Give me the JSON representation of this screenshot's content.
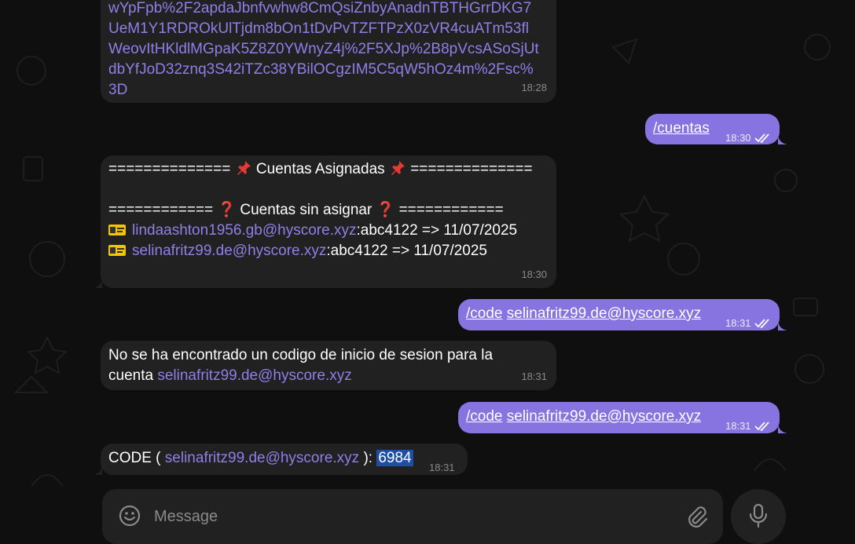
{
  "messages": [
    {
      "link_lines": [
        "wYpFpb%2F2apdaJbnfvwhw8CmQsiZnbyAnadnTBTHGrrDKG7",
        "UeM1Y1RDROkUlTjdm8bOn1tDvPvTZFTPzX0zVR4cuATm53fl",
        "WeovItHKldlMGpaK5Z8Z0YWnyZ4j%2F5XJp%2B8pVcsASoSjUt",
        "dbYfJoD32znq3S42iTZc38YBilOCgzIM5C5qW5hOz4m%2Fsc%",
        "3D"
      ],
      "time": "18:28"
    },
    {
      "command": "/cuentas",
      "time": "18:30"
    },
    {
      "header_prefix": "==============",
      "header_title": "Cuentas Asignadas",
      "header_suffix": "==============",
      "subheader_prefix": "============",
      "subheader_title": "Cuentas sin asignar",
      "subheader_suffix": "============",
      "accounts": [
        {
          "email": "lindaashton1956.gb@hyscore.xyz",
          "detail": ":abc4122 => 11/07/2025"
        },
        {
          "email": "selinafritz99.de@hyscore.xyz",
          "detail": ":abc4122 => 11/07/2025"
        }
      ],
      "time": "18:30"
    },
    {
      "command": "/code",
      "arg": "selinafritz99.de@hyscore.xyz",
      "time": "18:31"
    },
    {
      "text_line1": "No se ha encontrado un codigo de inicio de sesion para la",
      "text_line2": "cuenta",
      "email": "selinafritz99.de@hyscore.xyz",
      "time": "18:31"
    },
    {
      "command": "/code",
      "arg": "selinafritz99.de@hyscore.xyz",
      "time": "18:31"
    },
    {
      "prefix": "CODE (",
      "email": "selinafritz99.de@hyscore.xyz",
      "suffix": "):",
      "code": "6984",
      "time": "18:31"
    }
  ],
  "composer": {
    "placeholder": "Message"
  },
  "icons": {
    "emoji": "smile-icon",
    "attach": "paperclip-icon",
    "mic": "microphone-icon",
    "read": "double-check-icon"
  },
  "colors": {
    "outgoing": "#8774e1",
    "incoming": "#212121",
    "link": "#8f7fe8",
    "background": "#0f0f0f"
  }
}
